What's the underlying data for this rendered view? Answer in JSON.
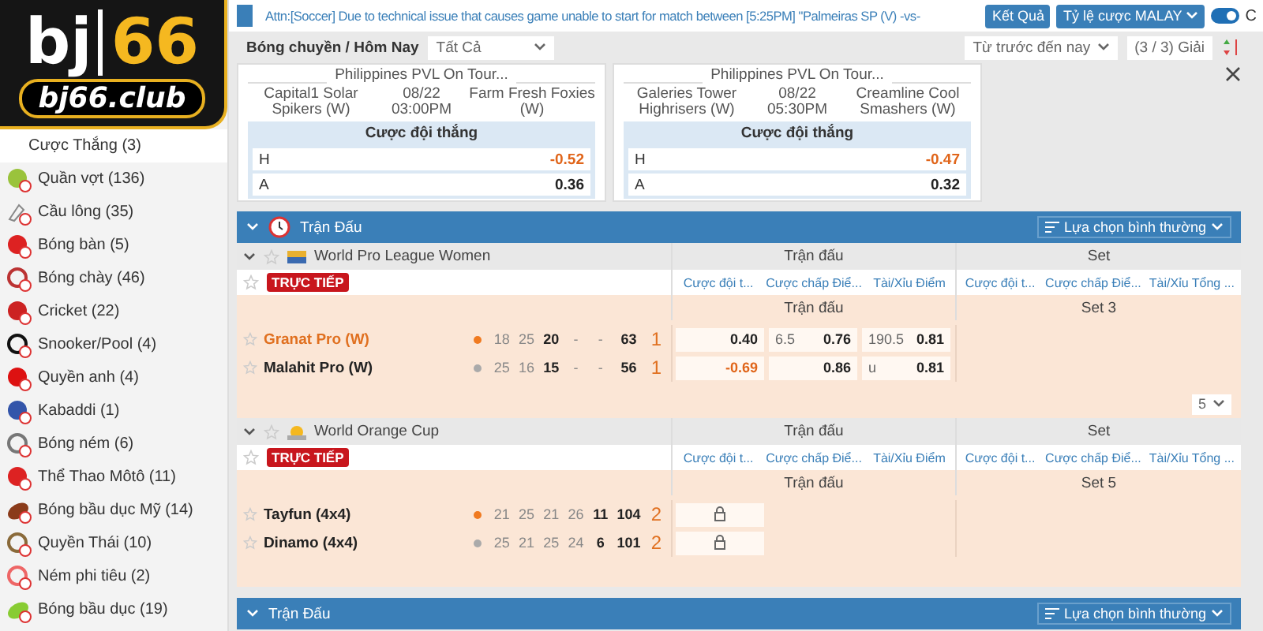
{
  "logo": {
    "brand": "bj",
    "number": "66",
    "domain": "bj66.club"
  },
  "notice": "Attn:[Soccer] Due to technical issue that causes game unable to start for match between [5:25PM] \"Palmeiras SP (V) -vs-",
  "header_buttons": [
    {
      "label": "Kết Quả",
      "kind": "plain"
    },
    {
      "label": "Tỷ lệ cược MALAY",
      "kind": "dropdown"
    }
  ],
  "toggle": {
    "on": true,
    "label": "C"
  },
  "sidebar": {
    "items": [
      {
        "label": "Cược Thắng (3)",
        "selected": true,
        "kind": "none"
      },
      {
        "label": "Quần vợt (136)",
        "selected": false,
        "kind": "tennis"
      },
      {
        "label": "Cầu lông (35)",
        "selected": false,
        "kind": "shuttle"
      },
      {
        "label": "Bóng bàn (5)",
        "selected": false,
        "kind": "pingpong"
      },
      {
        "label": "Bóng chày (46)",
        "selected": false,
        "kind": "baseball"
      },
      {
        "label": "Cricket (22)",
        "selected": false,
        "kind": "cricket"
      },
      {
        "label": "Snooker/Pool (4)",
        "selected": false,
        "kind": "snooker"
      },
      {
        "label": "Quyền anh (4)",
        "selected": false,
        "kind": "boxing"
      },
      {
        "label": "Kabaddi (1)",
        "selected": false,
        "kind": "kabaddi"
      },
      {
        "label": "Bóng ném (6)",
        "selected": false,
        "kind": "handball"
      },
      {
        "label": "Thể Thao Môtô (11)",
        "selected": false,
        "kind": "helmet"
      },
      {
        "label": "Bóng bầu dục Mỹ (14)",
        "selected": false,
        "kind": "football"
      },
      {
        "label": "Quyền Thái (10)",
        "selected": false,
        "kind": "muaythai"
      },
      {
        "label": "Ném phi tiêu (2)",
        "selected": false,
        "kind": "darts"
      },
      {
        "label": "Bóng bầu dục (19)",
        "selected": false,
        "kind": "rugby"
      }
    ]
  },
  "filter": {
    "title": "Bóng chuyền / Hôm Nay",
    "select": "Tất Cả",
    "period": "Từ trước đến nay",
    "count": "(3 / 3) Giải"
  },
  "cards": [
    {
      "league": "Philippines PVL On Tour...",
      "home": "Capital1 Solar Spikers (W)",
      "date": "08/22",
      "time": "03:00PM",
      "away": "Farm Fresh Foxies (W)",
      "market": "Cược đội thắng",
      "lines": [
        {
          "side": "H",
          "odds": "-0.52",
          "negative": true
        },
        {
          "side": "A",
          "odds": "0.36",
          "negative": false
        }
      ]
    },
    {
      "league": "Philippines PVL On Tour...",
      "home": "Galeries Tower Highrisers (W)",
      "date": "08/22",
      "time": "05:30PM",
      "away": "Creamline Cool Smashers (W)",
      "market": "Cược đội thắng",
      "lines": [
        {
          "side": "H",
          "odds": "-0.47",
          "negative": true
        },
        {
          "side": "A",
          "odds": "0.32",
          "negative": false
        }
      ]
    }
  ],
  "sections": [
    {
      "title": "Trận Đấu",
      "option": "Lựa chọn bình thường",
      "expanded": true,
      "clock": true,
      "leagues": [
        {
          "name": "World Pro League Women",
          "kind": "stripe",
          "groups": [
            "Trận đấu",
            "Set"
          ],
          "live": "TRỰC TIẾP",
          "columns": [
            "Cược đội t...",
            "Cược chấp Điể...",
            "Tài/Xỉu Điểm",
            "Cược đội t...",
            "Cược chấp Điể...",
            "Tài/Xỉu Tổng ..."
          ],
          "periods": [
            "Trận đấu",
            "Set 3"
          ],
          "pager": "5",
          "teams": [
            {
              "name": "Granat Pro (W)",
              "highlight": true,
              "serving": true,
              "scores": [
                "18",
                "25"
              ],
              "current": "20",
              "pending": [
                "-",
                "-"
              ],
              "total": "63",
              "sets": "1",
              "odds": [
                {
                  "price": "0.40",
                  "negative": false,
                  "locked": false
                },
                {
                  "line": "6.5",
                  "price": "0.76",
                  "negative": false,
                  "locked": false
                },
                {
                  "line": "190.5",
                  "price": "0.81",
                  "negative": false,
                  "locked": false
                }
              ]
            },
            {
              "name": "Malahit Pro (W)",
              "highlight": false,
              "serving": false,
              "scores": [
                "25",
                "16"
              ],
              "current": "15",
              "pending": [
                "-",
                "-"
              ],
              "total": "56",
              "sets": "1",
              "odds": [
                {
                  "price": "-0.69",
                  "negative": true,
                  "locked": false
                },
                {
                  "price": "0.86",
                  "negative": false,
                  "locked": false
                },
                {
                  "line": "u",
                  "price": "0.81",
                  "negative": false,
                  "locked": false
                }
              ]
            }
          ]
        },
        {
          "name": "World Orange Cup",
          "kind": "sun",
          "groups": [
            "Trận đấu",
            "Set"
          ],
          "live": "TRỰC TIẾP",
          "columns": [
            "Cược đội t...",
            "Cược chấp Điể...",
            "Tài/Xỉu Điểm",
            "Cược đội t...",
            "Cược chấp Điể...",
            "Tài/Xỉu Tổng ..."
          ],
          "periods": [
            "Trận đấu",
            "Set 5"
          ],
          "teams": [
            {
              "name": "Tayfun (4x4)",
              "highlight": false,
              "serving": true,
              "scores": [
                "21",
                "25",
                "21",
                "26"
              ],
              "current": "11",
              "total": "104",
              "sets": "2",
              "odds": [
                {
                  "locked": true
                }
              ]
            },
            {
              "name": "Dinamo (4x4)",
              "highlight": false,
              "serving": false,
              "scores": [
                "25",
                "21",
                "25",
                "24"
              ],
              "current": "6",
              "total": "101",
              "sets": "2",
              "odds": [
                {
                  "locked": true
                }
              ]
            }
          ]
        }
      ]
    },
    {
      "title": "Trận Đấu",
      "option": "Lựa chọn bình thường",
      "expanded": true,
      "clock": false
    }
  ]
}
